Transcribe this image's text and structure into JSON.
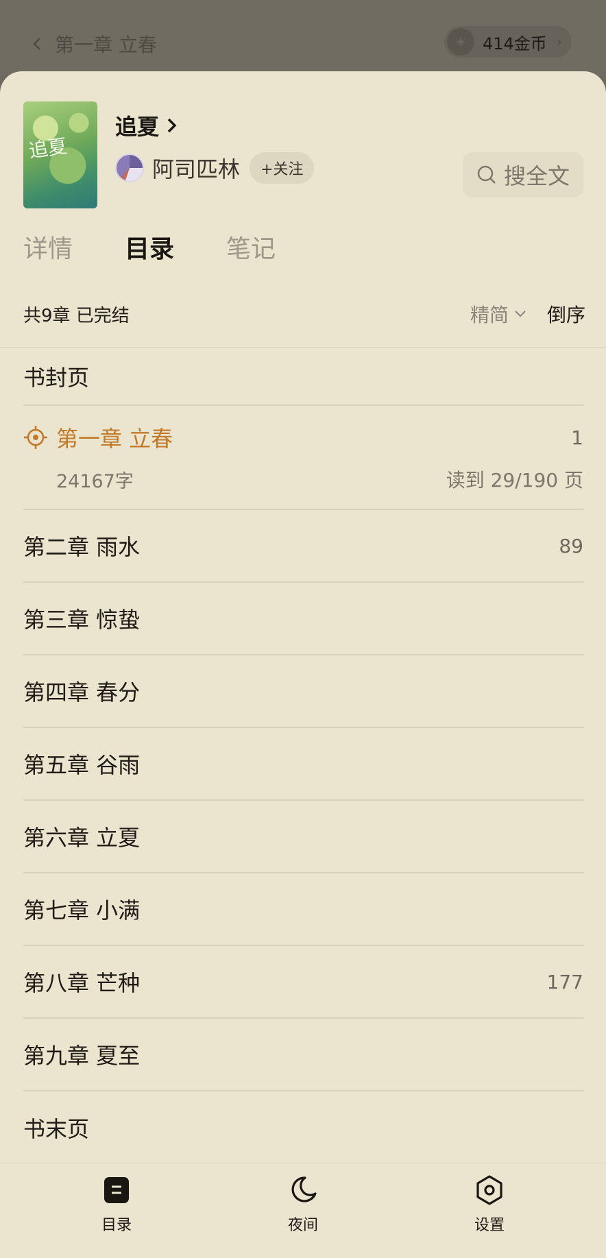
{
  "reader": {
    "chapter_title": "第一章 立春",
    "coins_label": "414金币"
  },
  "book": {
    "title": "追夏",
    "author": "阿司匹林",
    "follow_label": "+关注",
    "search_label": "搜全文",
    "cover_text": "追夏"
  },
  "tabs": [
    {
      "label": "详情"
    },
    {
      "label": "目录"
    },
    {
      "label": "笔记"
    }
  ],
  "toc": {
    "summary": "共9章 已完结",
    "mode_label": "精简",
    "order_label": "倒序",
    "front_page": "书封页",
    "current": {
      "title": "第一章 立春",
      "num": "1",
      "words": "24167字",
      "progress": "读到 29/190 页"
    },
    "chapters": [
      {
        "title": "第二章 雨水",
        "num": "89"
      },
      {
        "title": "第三章 惊蛰",
        "num": ""
      },
      {
        "title": "第四章 春分",
        "num": ""
      },
      {
        "title": "第五章 谷雨",
        "num": ""
      },
      {
        "title": "第六章 立夏",
        "num": ""
      },
      {
        "title": "第七章 小满",
        "num": ""
      },
      {
        "title": "第八章 芒种",
        "num": "177"
      },
      {
        "title": "第九章 夏至",
        "num": ""
      }
    ],
    "end_page": "书末页"
  },
  "bottom_nav": [
    {
      "label": "目录",
      "icon": "toc-icon"
    },
    {
      "label": "夜间",
      "icon": "moon-icon"
    },
    {
      "label": "设置",
      "icon": "settings-icon"
    }
  ],
  "colors": {
    "accent": "#c07a2a",
    "sheet": "#ebe4cf",
    "dim": "#716c62"
  }
}
